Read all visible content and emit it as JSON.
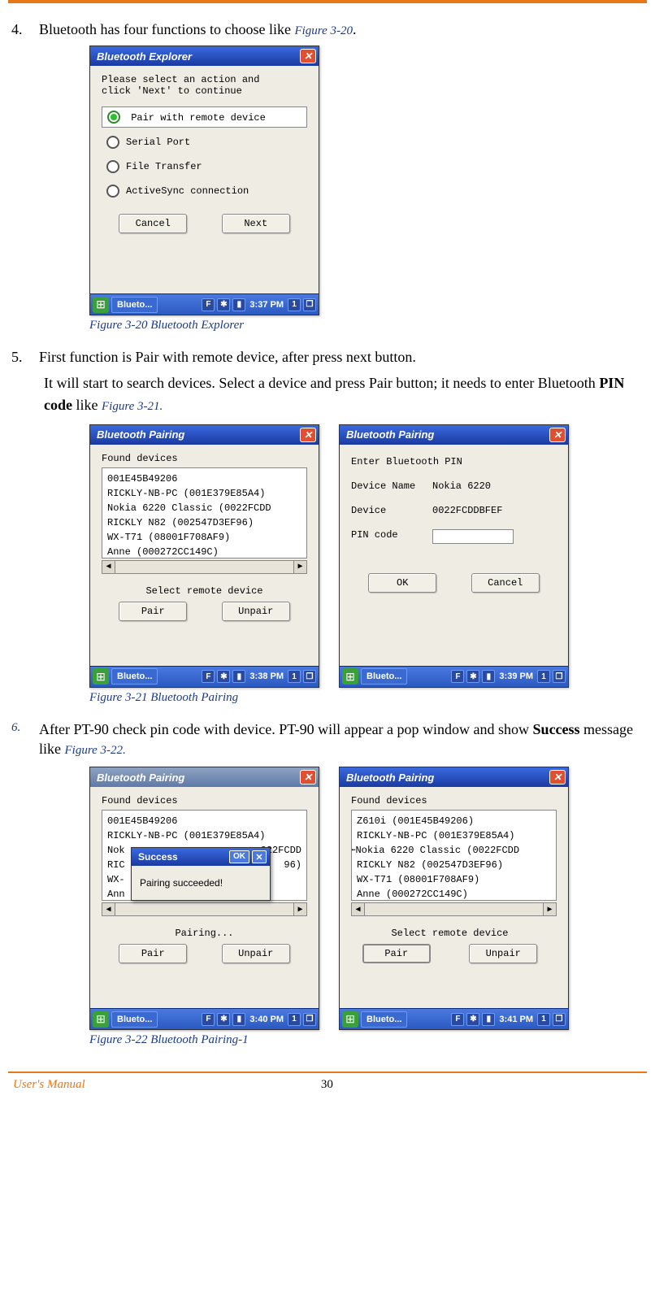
{
  "step4": {
    "num": "4.",
    "text": "Bluetooth has four functions to choose like ",
    "ref": "Figure 3-20",
    "after": "."
  },
  "fig20": {
    "title": "Bluetooth Explorer",
    "prompt1": "Please select an action and",
    "prompt2": "click 'Next'  to continue",
    "opt1": "Pair with remote device",
    "opt2": "Serial Port",
    "opt3": "File Transfer",
    "opt4": "ActiveSync connection",
    "cancel": "Cancel",
    "next": "Next",
    "task": "Blueto...",
    "time": "3:37 PM",
    "caption": "Figure 3-20 Bluetooth Explorer"
  },
  "step5": {
    "num": "5.",
    "line1": "First function is Pair with remote device, after press next button.",
    "line2a": "It will start to search devices. Select a device and press Pair button; it needs to enter Bluetooth ",
    "pin": "PIN code",
    "line2b": " like ",
    "ref": "Figure 3-21."
  },
  "fig21a": {
    "title": "Bluetooth Pairing",
    "found": "Found devices",
    "d1": "001E45B49206",
    "d2": "RICKLY-NB-PC (001E379E85A4)",
    "d3": "Nokia 6220 Classic (0022FCDD",
    "d4": "RICKLY N82 (002547D3EF96)",
    "d5": "WX-T71 (08001F708AF9)",
    "d6": "Anne (000272CC149C)",
    "sub": "Select remote device",
    "pair": "Pair",
    "unpair": "Unpair",
    "task": "Blueto...",
    "time": "3:38 PM"
  },
  "fig21b": {
    "title": "Bluetooth Pairing",
    "enter": "Enter Bluetooth PIN",
    "dn_l": "Device Name",
    "dn_v": "Nokia 6220",
    "dv_l": "Device",
    "dv_v": "0022FCDDBFEF",
    "pc_l": "PIN code",
    "ok": "OK",
    "cancel": "Cancel",
    "task": "Blueto...",
    "time": "3:39 PM"
  },
  "cap21": "Figure 3-21 Bluetooth Pairing",
  "step6": {
    "num": "6.",
    "line1a": "After PT-90 check pin code with device. PT-90 will appear a pop window and show ",
    "success": "Success",
    "line1b": " message like ",
    "ref": "Figure 3-22."
  },
  "fig22a": {
    "title": "Bluetooth Pairing",
    "found": "Found devices",
    "d1": "001E45B49206",
    "d2": "RICKLY-NB-PC (001E379E85A4)",
    "d3": "Nok",
    "d3b": "022FCDD",
    "d4": "RIC",
    "d4b": "96)",
    "d5": "WX-",
    "d6": "Ann",
    "sub": "Pairing...",
    "pair": "Pair",
    "unpair": "Unpair",
    "popup_title": "Success",
    "popup_ok": "OK",
    "popup_msg": "Pairing succeeded!",
    "task": "Blueto...",
    "time": "3:40 PM"
  },
  "fig22b": {
    "title": "Bluetooth Pairing",
    "found": "Found devices",
    "d1": "Z610i (001E45B49206)",
    "d2": "RICKLY-NB-PC (001E379E85A4)",
    "d3pre": "O⟜",
    "d3": "Nokia 6220 Classic (0022FCDD",
    "d4": "RICKLY N82 (002547D3EF96)",
    "d5": "WX-T71 (08001F708AF9)",
    "d6": "Anne (000272CC149C)",
    "sub": "Select remote device",
    "pair": "Pair",
    "unpair": "Unpair",
    "task": "Blueto...",
    "time": "3:41 PM"
  },
  "cap22": "Figure 3-22 Bluetooth Pairing-1",
  "footer": {
    "left": "User's Manual",
    "page": "30"
  },
  "icons": {
    "f": "F",
    "bt": "✱",
    "batt": "▮",
    "one": "1",
    "stack": "❐"
  }
}
